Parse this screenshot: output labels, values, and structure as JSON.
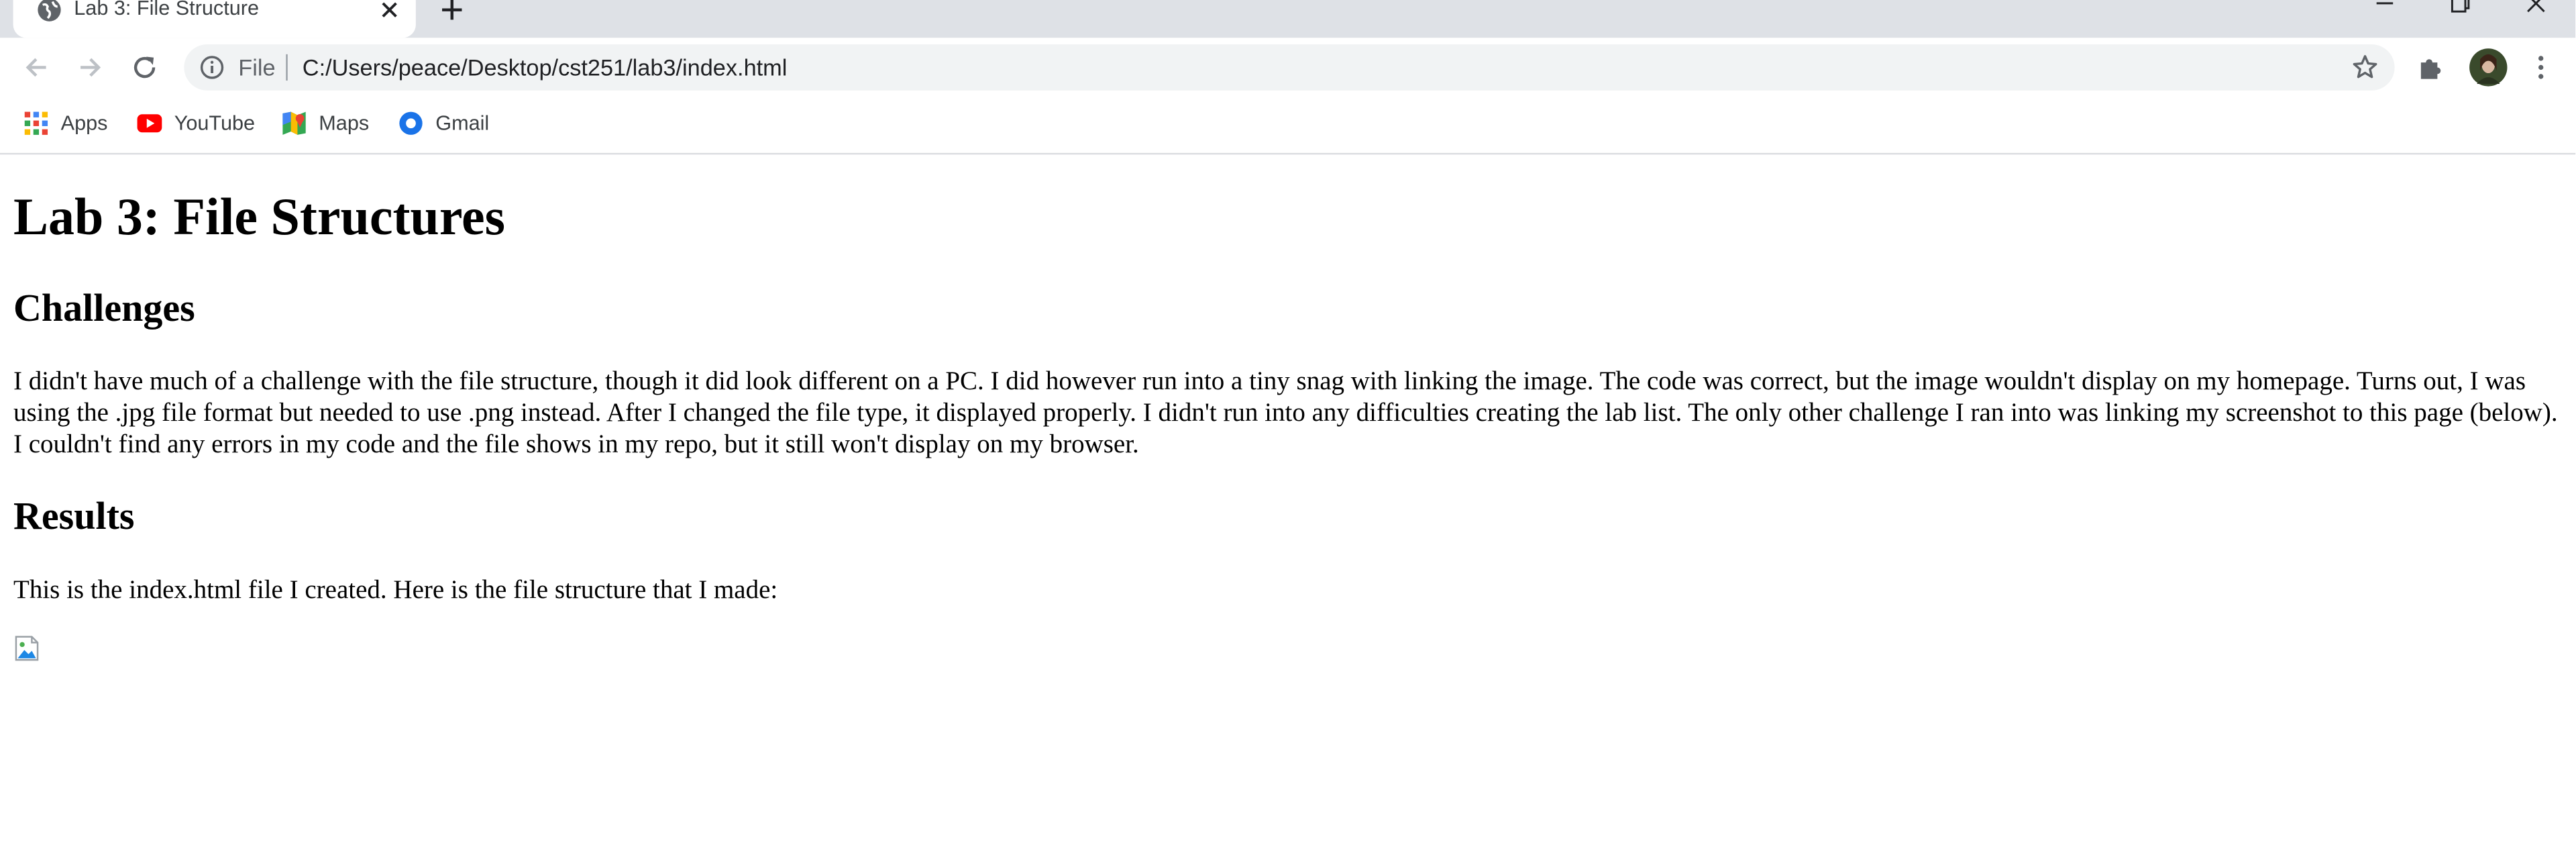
{
  "browser": {
    "tab": {
      "title": "Lab 3: File Structure"
    },
    "omnibox": {
      "scheme_label": "File",
      "url": "C:/Users/peace/Desktop/cst251/lab3/index.html"
    },
    "bookmarks": [
      {
        "label": "Apps",
        "icon": "apps-grid-icon"
      },
      {
        "label": "YouTube",
        "icon": "youtube-icon"
      },
      {
        "label": "Maps",
        "icon": "maps-icon"
      },
      {
        "label": "Gmail",
        "icon": "gmail-icon"
      }
    ]
  },
  "page": {
    "title": "Lab 3: File Structures",
    "challenges_heading": "Challenges",
    "challenges_text": "I didn't have much of a challenge with the file structure, though it did look different on a PC. I did however run into a tiny snag with linking the image. The code was correct, but the image wouldn't display on my homepage. Turns out, I was using the .jpg file format but needed to use .png instead. After I changed the file type, it displayed properly. I didn't run into any difficulties creating the lab list. The only other challenge I ran into was linking my screenshot to this page (below). I couldn't find any errors in my code and the file shows in my repo, but it still won't display on my browser.",
    "results_heading": "Results",
    "results_text": "This is the index.html file I created. Here is the file structure that I made:"
  },
  "colors": {
    "tab_strip": "#dee1e6",
    "omnibox_bg": "#f1f3f4",
    "youtube_red": "#ff0000",
    "gmail_blue": "#1a73e8"
  }
}
